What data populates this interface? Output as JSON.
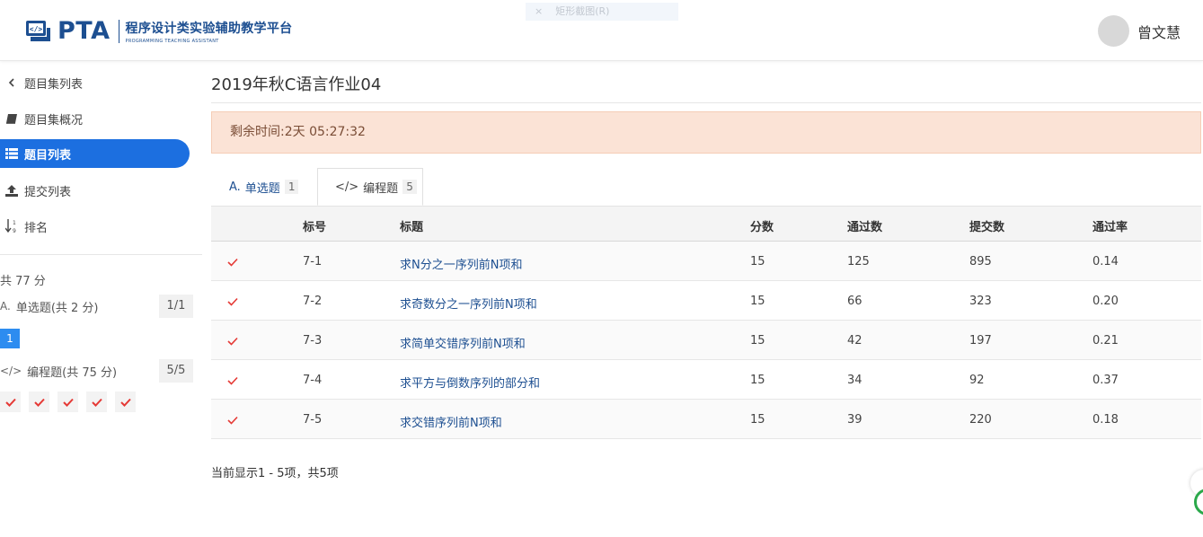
{
  "header": {
    "logo_text": "PTA",
    "logo_cn": "程序设计类实验辅助教学平台",
    "logo_en": "PROGRAMMING TEACHING ASSISTANT",
    "ghost_tab": "矩形截图(R)",
    "username": "曾文慧"
  },
  "sidebar": {
    "items": [
      {
        "label": "题目集列表",
        "icon": "chevron-left-icon"
      },
      {
        "label": "题目集概况",
        "icon": "book-icon"
      },
      {
        "label": "题目列表",
        "icon": "list-icon"
      },
      {
        "label": "提交列表",
        "icon": "upload-icon"
      },
      {
        "label": "排名",
        "icon": "sort-numeric-icon"
      }
    ],
    "total": "共 77 分",
    "categories": [
      {
        "prefix": "A.",
        "label": "单选题(共 2 分)",
        "count": "1/1"
      },
      {
        "prefix": "</>",
        "label": "编程题(共 75 分)",
        "count": "5/5"
      }
    ],
    "choice_numbers": [
      "1"
    ]
  },
  "main": {
    "title": "2019年秋C语言作业04",
    "alert": "剩余时间:2天 05:27:32",
    "tabs": [
      {
        "prefix": "A.",
        "label": "单选题",
        "count": "1"
      },
      {
        "prefix": "</>",
        "label": "编程题",
        "count": "5"
      }
    ],
    "table": {
      "headers": [
        "标号",
        "标题",
        "分数",
        "通过数",
        "提交数",
        "通过率"
      ],
      "rows": [
        {
          "no": "7-1",
          "title": "求N分之一序列前N项和",
          "score": "15",
          "pass": "125",
          "submit": "895",
          "rate": "0.14"
        },
        {
          "no": "7-2",
          "title": "求奇数分之一序列前N项和",
          "score": "15",
          "pass": "66",
          "submit": "323",
          "rate": "0.20"
        },
        {
          "no": "7-3",
          "title": "求简单交错序列前N项和",
          "score": "15",
          "pass": "42",
          "submit": "197",
          "rate": "0.21"
        },
        {
          "no": "7-4",
          "title": "求平方与倒数序列的部分和",
          "score": "15",
          "pass": "34",
          "submit": "92",
          "rate": "0.37"
        },
        {
          "no": "7-5",
          "title": "求交错序列前N项和",
          "score": "15",
          "pass": "39",
          "submit": "220",
          "rate": "0.18"
        }
      ]
    },
    "footer": "当前显示1 - 5项，共5项"
  },
  "colors": {
    "brand": "#1d4f91",
    "active_nav": "#1c6fe0",
    "alert_bg": "#fbe3d6",
    "check": "#e53935"
  }
}
